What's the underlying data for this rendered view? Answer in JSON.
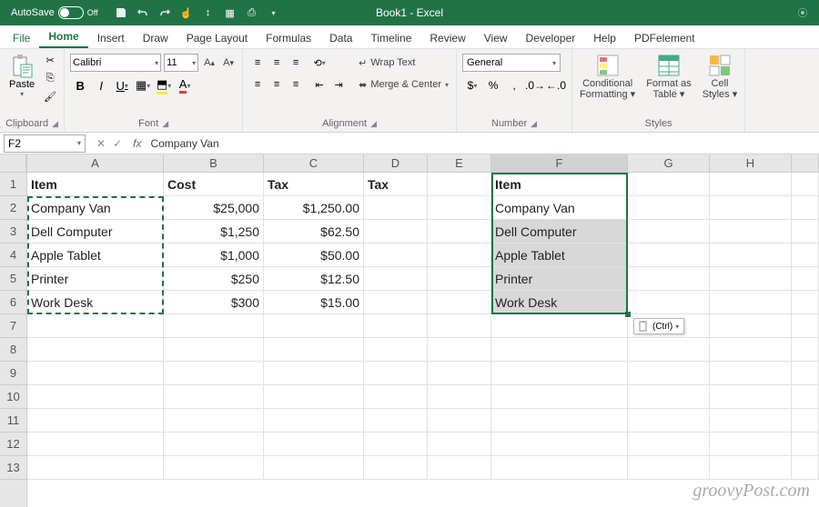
{
  "titlebar": {
    "autosave": "AutoSave",
    "off": "Off",
    "title": "Book1 - Excel"
  },
  "tabs": [
    "File",
    "Home",
    "Insert",
    "Draw",
    "Page Layout",
    "Formulas",
    "Data",
    "Timeline",
    "Review",
    "View",
    "Developer",
    "Help",
    "PDFelement"
  ],
  "ribbon": {
    "clipboard": {
      "paste": "Paste",
      "label": "Clipboard"
    },
    "font": {
      "name": "Calibri",
      "size": "11",
      "label": "Font"
    },
    "alignment": {
      "wrap": "Wrap Text",
      "merge": "Merge & Center",
      "label": "Alignment"
    },
    "number": {
      "format": "General",
      "label": "Number"
    },
    "styles": {
      "cond": "Conditional",
      "cond2": "Formatting",
      "fmt": "Format as",
      "fmt2": "Table",
      "cell": "Cell",
      "cell2": "Styles",
      "label": "Styles"
    }
  },
  "formula": {
    "nameref": "F2",
    "value": "Company Van"
  },
  "columns": [
    "A",
    "B",
    "C",
    "D",
    "E",
    "F",
    "G",
    "H"
  ],
  "rows": [
    "1",
    "2",
    "3",
    "4",
    "5",
    "6",
    "7",
    "8",
    "9",
    "10",
    "11",
    "12",
    "13"
  ],
  "data": {
    "A1": "Item",
    "B1": "Cost",
    "C1": "Tax",
    "D1": "Tax",
    "F1": "Item",
    "A2": "Company Van",
    "B2": "$25,000",
    "C2": "$1,250.00",
    "F2": "Company Van",
    "A3": "Dell Computer",
    "B3": "$1,250",
    "C3": "$62.50",
    "F3": "Dell Computer",
    "A4": "Apple Tablet",
    "B4": "$1,000",
    "C4": "$50.00",
    "F4": "Apple Tablet",
    "A5": "Printer",
    "B5": "$250",
    "C5": "$12.50",
    "F5": "Printer",
    "A6": "Work Desk",
    "B6": "$300",
    "C6": "$15.00",
    "F6": "Work Desk"
  },
  "paste_tag": "(Ctrl)",
  "watermark": "groovyPost.com"
}
